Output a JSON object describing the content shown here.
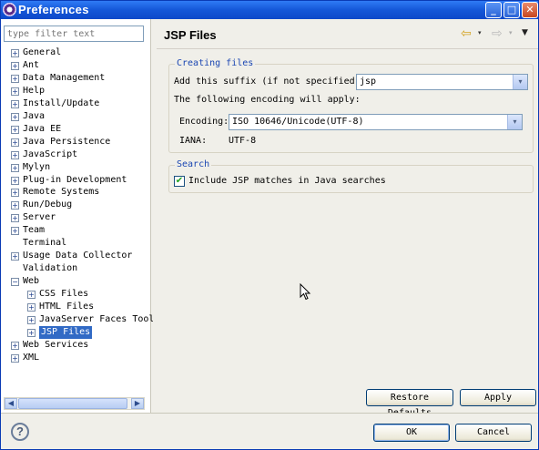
{
  "window": {
    "title": "Preferences",
    "controls": {
      "minimize": "_",
      "maximize": "□",
      "close": "✕"
    }
  },
  "filter": {
    "placeholder": "type filter text"
  },
  "tree": {
    "items": [
      {
        "label": "General",
        "expander": "+",
        "level": 0
      },
      {
        "label": "Ant",
        "expander": "+",
        "level": 0
      },
      {
        "label": "Data Management",
        "expander": "+",
        "level": 0
      },
      {
        "label": "Help",
        "expander": "+",
        "level": 0
      },
      {
        "label": "Install/Update",
        "expander": "+",
        "level": 0
      },
      {
        "label": "Java",
        "expander": "+",
        "level": 0
      },
      {
        "label": "Java EE",
        "expander": "+",
        "level": 0
      },
      {
        "label": "Java Persistence",
        "expander": "+",
        "level": 0
      },
      {
        "label": "JavaScript",
        "expander": "+",
        "level": 0
      },
      {
        "label": "Mylyn",
        "expander": "+",
        "level": 0
      },
      {
        "label": "Plug-in Development",
        "expander": "+",
        "level": 0
      },
      {
        "label": "Remote Systems",
        "expander": "+",
        "level": 0
      },
      {
        "label": "Run/Debug",
        "expander": "+",
        "level": 0
      },
      {
        "label": "Server",
        "expander": "+",
        "level": 0
      },
      {
        "label": "Team",
        "expander": "+",
        "level": 0
      },
      {
        "label": "Terminal",
        "expander": "",
        "level": 0
      },
      {
        "label": "Usage Data Collector",
        "expander": "+",
        "level": 0
      },
      {
        "label": "Validation",
        "expander": "",
        "level": 0
      },
      {
        "label": "Web",
        "expander": "−",
        "level": 0
      },
      {
        "label": "CSS Files",
        "expander": "+",
        "level": 1
      },
      {
        "label": "HTML Files",
        "expander": "+",
        "level": 1
      },
      {
        "label": "JavaServer Faces Tool",
        "expander": "+",
        "level": 1
      },
      {
        "label": "JSP Files",
        "expander": "+",
        "level": 1,
        "selected": true
      },
      {
        "label": "Web Services",
        "expander": "+",
        "level": 0
      },
      {
        "label": "XML",
        "expander": "+",
        "level": 0
      }
    ]
  },
  "page": {
    "title": "JSP Files",
    "nav": {
      "back": "⇦",
      "forward": "⇨",
      "dropdown": "▾",
      "menu": "▼"
    }
  },
  "creating_files": {
    "legend": "Creating files",
    "suffix_label": "Add this suffix (if not specified):",
    "suffix_value": "jsp",
    "encoding_intro": "The following encoding will apply:",
    "encoding_label": "Encoding:",
    "encoding_value": "ISO 10646/Unicode(UTF-8)",
    "iana_label": "IANA:",
    "iana_value": "UTF-8"
  },
  "search": {
    "legend": "Search",
    "include_label": "Include JSP matches in Java searches",
    "include_checked": true,
    "check_glyph": "✔"
  },
  "buttons": {
    "restore_defaults": "Restore Defaults",
    "apply": "Apply",
    "ok": "OK",
    "cancel": "Cancel",
    "help": "?"
  },
  "scrollbar": {
    "left": "◀",
    "right": "▶"
  },
  "colors": {
    "titlebar": "#1457d8",
    "selection": "#316ac5",
    "group_legend": "#1a46b2"
  }
}
